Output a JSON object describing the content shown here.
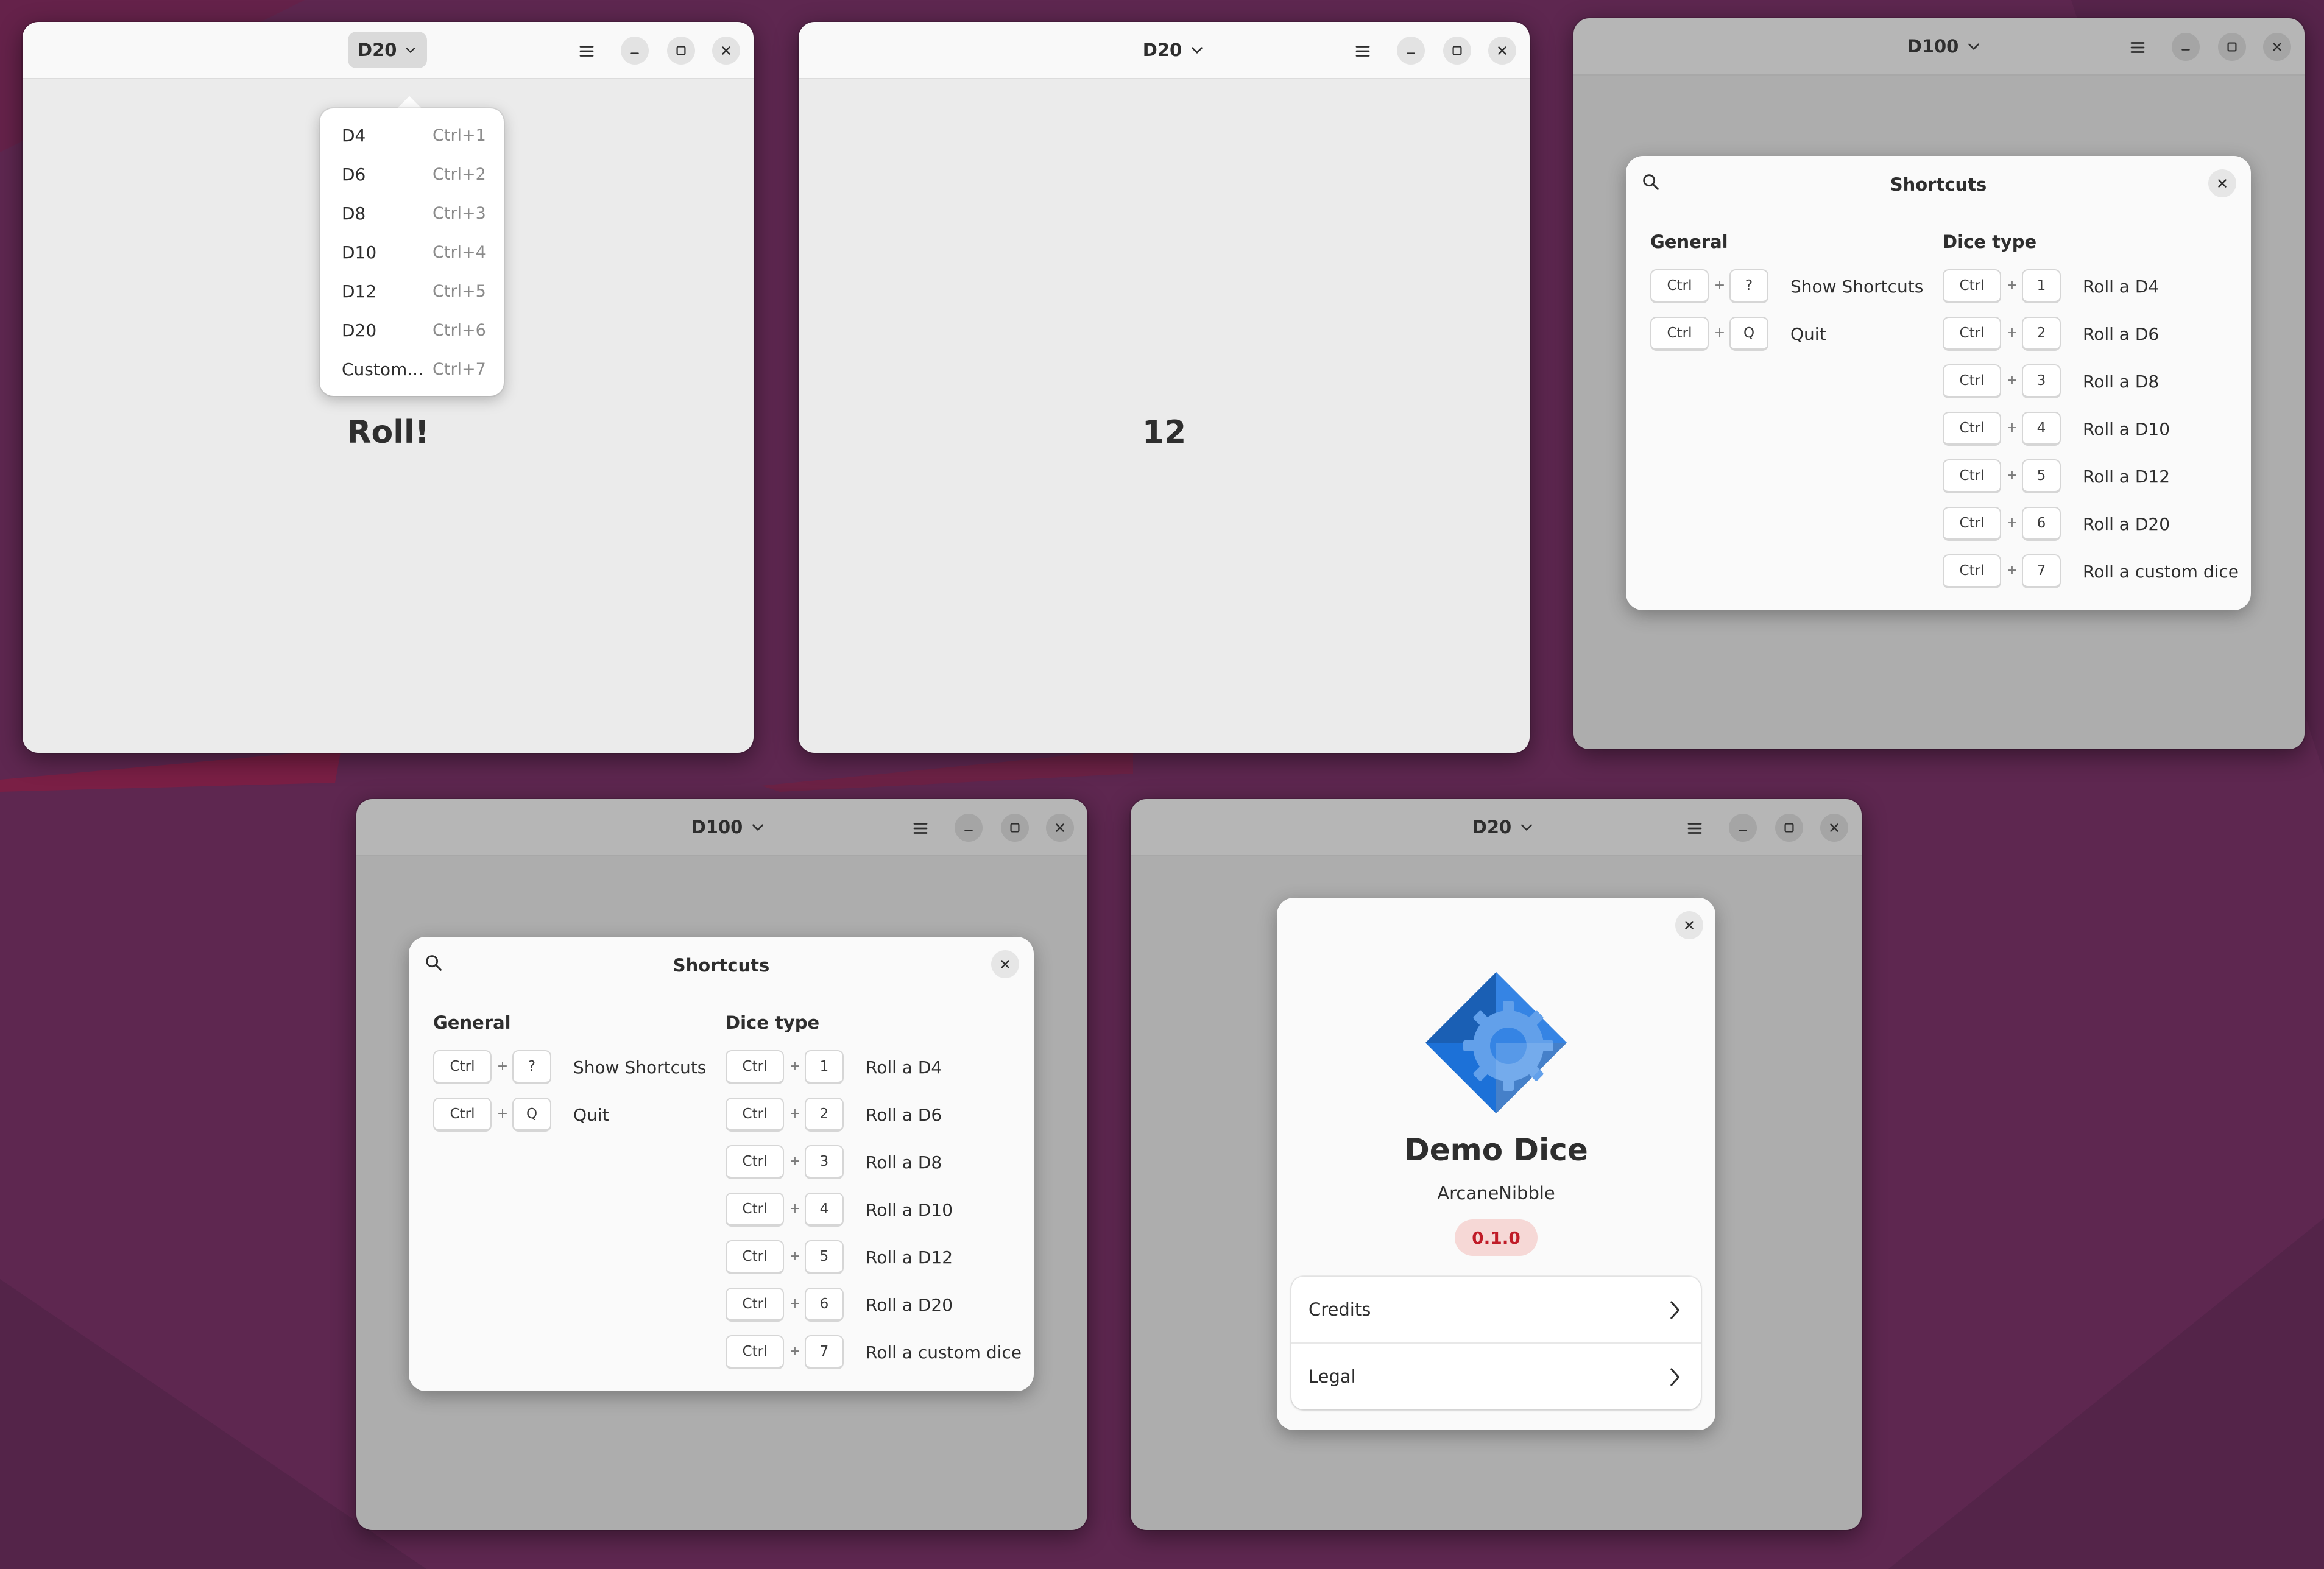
{
  "palette": {
    "desktop": "#5e2750",
    "accent_red": "#c01c28",
    "icon_blue": "#1c71d8"
  },
  "windows": {
    "w1": {
      "title": "D20",
      "menu": [
        {
          "label": "D4",
          "accel": "Ctrl+1"
        },
        {
          "label": "D6",
          "accel": "Ctrl+2"
        },
        {
          "label": "D8",
          "accel": "Ctrl+3"
        },
        {
          "label": "D10",
          "accel": "Ctrl+4"
        },
        {
          "label": "D12",
          "accel": "Ctrl+5"
        },
        {
          "label": "D20",
          "accel": "Ctrl+6"
        },
        {
          "label": "Custom...",
          "accel": "Ctrl+7"
        }
      ],
      "main_text": "Roll!"
    },
    "w2": {
      "title": "D20",
      "main_text": "12"
    },
    "w3": {
      "title": "D100"
    },
    "w4": {
      "title": "D100"
    },
    "w5": {
      "title": "D20"
    }
  },
  "shortcuts": {
    "title": "Shortcuts",
    "general": {
      "heading": "General",
      "items": [
        {
          "mod": "Ctrl",
          "plus": "+",
          "key": "?",
          "desc": "Show Shortcuts"
        },
        {
          "mod": "Ctrl",
          "plus": "+",
          "key": "Q",
          "desc": "Quit"
        }
      ]
    },
    "dice": {
      "heading": "Dice type",
      "items": [
        {
          "mod": "Ctrl",
          "plus": "+",
          "key": "1",
          "desc": "Roll a D4"
        },
        {
          "mod": "Ctrl",
          "plus": "+",
          "key": "2",
          "desc": "Roll a D6"
        },
        {
          "mod": "Ctrl",
          "plus": "+",
          "key": "3",
          "desc": "Roll a D8"
        },
        {
          "mod": "Ctrl",
          "plus": "+",
          "key": "4",
          "desc": "Roll a D10"
        },
        {
          "mod": "Ctrl",
          "plus": "+",
          "key": "5",
          "desc": "Roll a D12"
        },
        {
          "mod": "Ctrl",
          "plus": "+",
          "key": "6",
          "desc": "Roll a D20"
        },
        {
          "mod": "Ctrl",
          "plus": "+",
          "key": "7",
          "desc": "Roll a custom dice"
        }
      ]
    }
  },
  "about": {
    "app_name": "Demo Dice",
    "developer": "ArcaneNibble",
    "version": "0.1.0",
    "rows": [
      {
        "label": "Credits"
      },
      {
        "label": "Legal"
      }
    ]
  },
  "icons": {
    "dropdown": "chevron-down-icon",
    "menu": "hamburger-menu-icon",
    "minimize": "minimize-icon",
    "maximize": "maximize-icon",
    "close": "close-icon",
    "search": "search-icon",
    "row_arrow": "chevron-right-icon",
    "app": "app-logo-icon"
  }
}
